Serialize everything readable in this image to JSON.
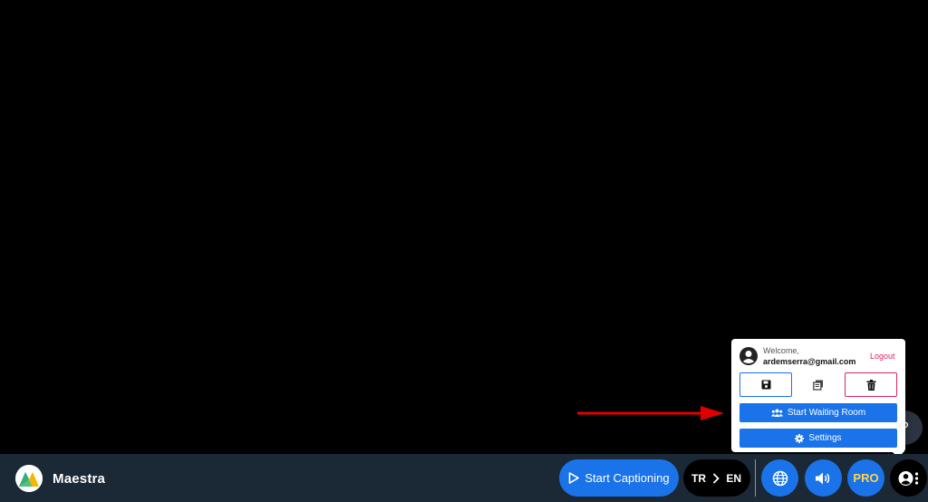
{
  "app": {
    "name": "Maestra"
  },
  "toolbar": {
    "start_captioning_label": "Start Captioning",
    "source_lang": "TR",
    "target_lang": "EN",
    "pro_label": "PRO",
    "help_glyph": "?"
  },
  "popup": {
    "welcome": "Welcome,",
    "email": "ardemserra@gmail.com",
    "logout": "Logout",
    "start_waiting_room": "Start Waiting Room",
    "settings": "Settings"
  },
  "colors": {
    "accent": "#1a73e8",
    "bar": "#1b2836",
    "danger": "#e0245e",
    "pro": "#ffd34d",
    "annotation": "#e00000"
  },
  "icons": [
    "save-icon",
    "copy-icon",
    "trash-icon",
    "users-icon",
    "gear-icon",
    "globe-icon",
    "speaker-icon",
    "user-menu-icon",
    "play-icon",
    "chevron-right-icon"
  ]
}
